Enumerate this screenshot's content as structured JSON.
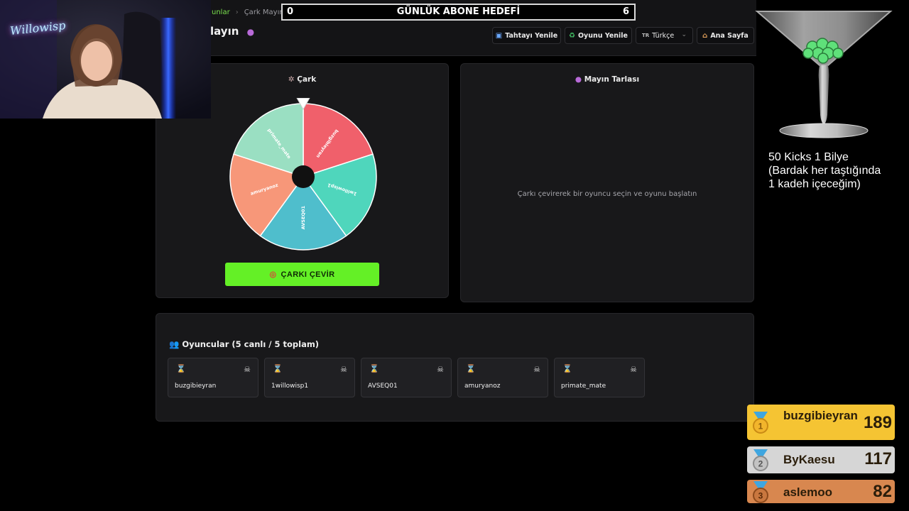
{
  "header": {
    "breadcrumb": {
      "link": "unlar",
      "current": "Çark Mayın"
    },
    "title": "layın",
    "title_icon": "bomb-icon",
    "buttons": {
      "refresh_board": "Tahtayı Yenile",
      "restart_game": "Oyunu Yenile",
      "language_flag": "TR",
      "language": "Türkçe",
      "home": "Ana Sayfa"
    }
  },
  "wheel": {
    "title": "Çark",
    "title_icon": "ferris-wheel-icon",
    "segments": [
      {
        "label": "buzgibieyran",
        "color": "#f0606b"
      },
      {
        "label": "1willowisp1",
        "color": "#4fd6bc"
      },
      {
        "label": "AVSEQ01",
        "color": "#4fbecc"
      },
      {
        "label": "amuryanoz",
        "color": "#f79779"
      },
      {
        "label": "primate_mate",
        "color": "#9adfc2"
      }
    ],
    "spin_label": "ÇARKI ÇEVİR",
    "spin_icon": "target-icon",
    "spin_color": "#64f026"
  },
  "minefield": {
    "title": "Mayın Tarlası",
    "title_icon": "bomb-icon",
    "message": "Çarkı çevirerek bir oyuncu seçin ve oyunu başlatın"
  },
  "players": {
    "title": "Oyuncular (5 canlı / 5 toplam)",
    "title_icon": "people-icon",
    "list": [
      {
        "name": "buzgibieyran",
        "status_icon": "hourglass-icon",
        "action_icon": "skull-crossbones-icon"
      },
      {
        "name": "1willowisp1",
        "status_icon": "hourglass-icon",
        "action_icon": "skull-crossbones-icon"
      },
      {
        "name": "AVSEQ01",
        "status_icon": "hourglass-icon",
        "action_icon": "skull-crossbones-icon"
      },
      {
        "name": "amuryanoz",
        "status_icon": "hourglass-icon",
        "action_icon": "skull-crossbones-icon"
      },
      {
        "name": "primate_mate",
        "status_icon": "hourglass-icon",
        "action_icon": "skull-crossbones-icon"
      }
    ]
  },
  "goal": {
    "start": "0",
    "label": "GÜNLÜK ABONE HEDEFİ",
    "end": "6"
  },
  "webcam": {
    "logo": "Willowisp"
  },
  "marble_note": {
    "lines": [
      "50 Kicks 1 Bilye",
      "(Bardak her taştığında",
      "1 kadeh içeceğim)"
    ]
  },
  "leaderboard": [
    {
      "rank": "1",
      "name": "buzgibieyran",
      "score": "189",
      "color": "#f5c433"
    },
    {
      "rank": "2",
      "name": "ByKaesu",
      "score": "117",
      "color": "#d6d6d6"
    },
    {
      "rank": "3",
      "name": "aslemoo",
      "score": "82",
      "color": "#d8874f"
    }
  ]
}
